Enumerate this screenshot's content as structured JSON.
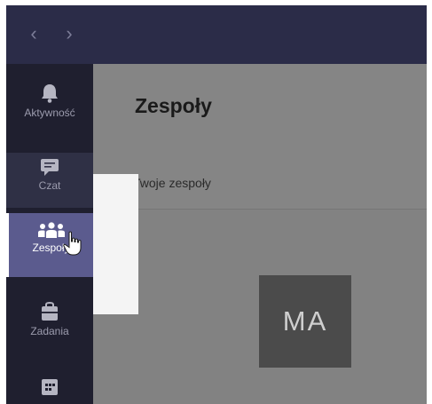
{
  "titlebar": {
    "back_icon": "chevron-left-icon",
    "forward_icon": "chevron-right-icon",
    "back_glyph": "‹",
    "forward_glyph": "›"
  },
  "rail": {
    "items": [
      {
        "label": "Aktywność",
        "icon": "bell-icon"
      },
      {
        "label": "Czat",
        "icon": "chat-icon"
      },
      {
        "label": "Zespoły",
        "icon": "teams-icon",
        "active": true
      },
      {
        "label": "Zadania",
        "icon": "assignments-icon"
      },
      {
        "label": "",
        "icon": "calendar-icon"
      }
    ]
  },
  "main": {
    "title": "Zespoły",
    "section_label": "Twoje zespoły",
    "team_tile": {
      "initials": "MA"
    }
  },
  "colors": {
    "titlebar": "#2b2c48",
    "rail": "#1f1f2f",
    "active_item": "#5b5b8e",
    "content_overlay": "#828282"
  }
}
